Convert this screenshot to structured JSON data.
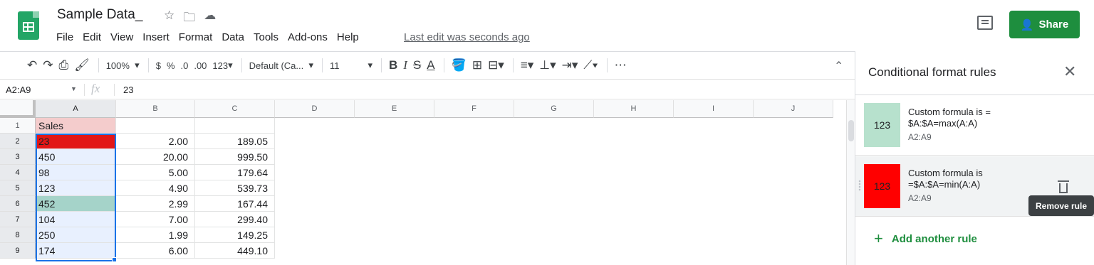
{
  "header": {
    "doc_title": "Sample Data_",
    "menu": [
      "File",
      "Edit",
      "View",
      "Insert",
      "Format",
      "Data",
      "Tools",
      "Add-ons",
      "Help"
    ],
    "last_edit": "Last edit was seconds ago",
    "share_label": "Share"
  },
  "toolbar": {
    "zoom": "100%",
    "currency": "$",
    "percent": "%",
    "decimal_decrease": ".0",
    "decimal_increase": ".00",
    "more_formats": "123",
    "font": "Default (Ca...",
    "font_size": "11",
    "bold": "B",
    "italic": "I",
    "strike": "S",
    "text_color": "A",
    "more": "⋯"
  },
  "formula_bar": {
    "name_box": "A2:A9",
    "fx": "fx",
    "value": "23"
  },
  "sheet": {
    "columns": [
      "A",
      "B",
      "C",
      "D",
      "E",
      "F",
      "G",
      "H",
      "I",
      "J"
    ],
    "rows": [
      {
        "num": "1",
        "a": "Sales",
        "b": "",
        "c": ""
      },
      {
        "num": "2",
        "a": "23",
        "b": "2.00",
        "c": "189.05"
      },
      {
        "num": "3",
        "a": "450",
        "b": "20.00",
        "c": "999.50"
      },
      {
        "num": "4",
        "a": "98",
        "b": "5.00",
        "c": "179.64"
      },
      {
        "num": "5",
        "a": "123",
        "b": "4.90",
        "c": "539.73"
      },
      {
        "num": "6",
        "a": "452",
        "b": "2.99",
        "c": "167.44"
      },
      {
        "num": "7",
        "a": "104",
        "b": "7.00",
        "c": "299.40"
      },
      {
        "num": "8",
        "a": "250",
        "b": "1.99",
        "c": "149.25"
      },
      {
        "num": "9",
        "a": "174",
        "b": "6.00",
        "c": "449.10"
      }
    ],
    "colors": {
      "header_fill": "#f4cccc",
      "min_fill": "#e21717",
      "max_fill": "#a5d3c9",
      "selection_fill": "#e8f0fe"
    }
  },
  "panel": {
    "title": "Conditional format rules",
    "rules": [
      {
        "preview": "123",
        "desc": "Custom formula is = $A:$A=max(A:A)",
        "range": "A2:A9",
        "color": "#b7e1cd"
      },
      {
        "preview": "123",
        "desc": "Custom formula is =$A:$A=min(A:A)",
        "range": "A2:A9",
        "color": "#ff0000"
      }
    ],
    "tooltip": "Remove rule",
    "add_rule": "Add another rule"
  }
}
